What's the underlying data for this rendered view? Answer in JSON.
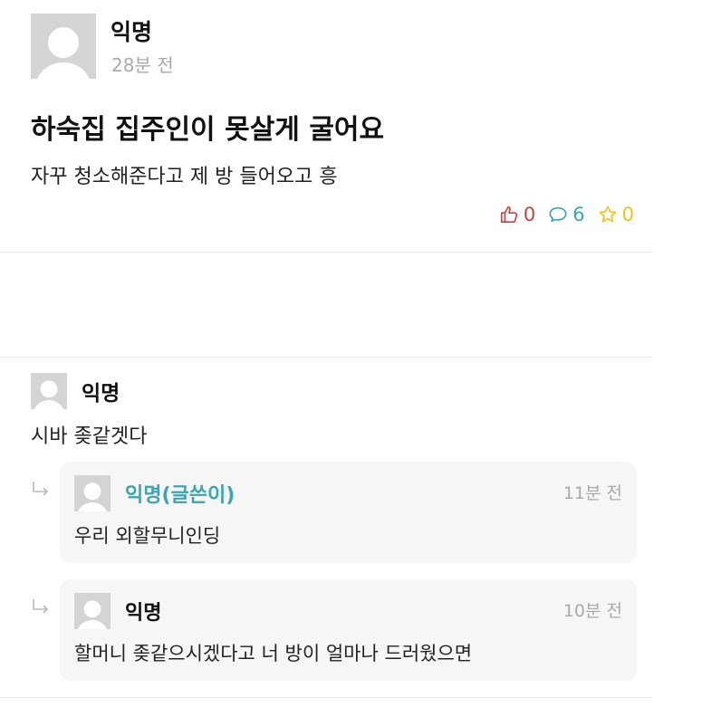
{
  "post": {
    "author": "익명",
    "time": "28분 전",
    "title": "하숙집 집주인이 못살게 굴어요",
    "body": "자꾸 청소해준다고 제 방 들어오고 흥",
    "likes": "0",
    "comments": "6",
    "scraps": "0"
  },
  "comment": {
    "author": "익명",
    "text": "시바 좆같겟다"
  },
  "replies": [
    {
      "author": "익명(글쓴이)",
      "time": "11분 전",
      "text": "우리 외할무니인딩"
    },
    {
      "author": "익명",
      "time": "10분 전",
      "text": "할머니 좆같으시겠다고 너 방이 얼마나 드러웠으면"
    }
  ],
  "colors": {
    "like": "#c6423f",
    "comment": "#3ba5b0",
    "scrap": "#f0c21e",
    "op_name": "#3ba5b0"
  }
}
